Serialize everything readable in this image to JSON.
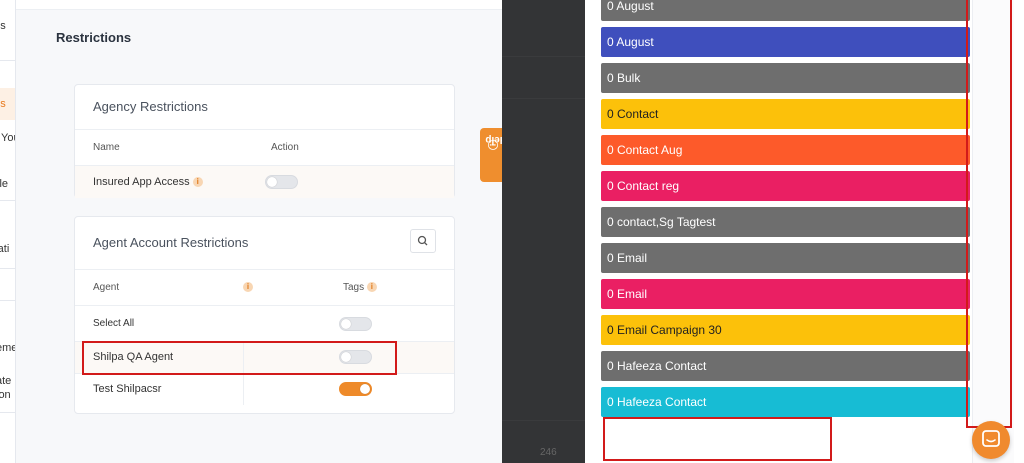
{
  "sidebar": {
    "fragments": [
      "ons",
      "ons",
      "You",
      "ile",
      "rati",
      "eme",
      "ate",
      "ion"
    ]
  },
  "page": {
    "title": "Restrictions"
  },
  "agency_card": {
    "title": "Agency Restrictions",
    "col_name": "Name",
    "col_action": "Action",
    "rows": [
      {
        "label": "Insured App Access",
        "enabled": false
      }
    ]
  },
  "agent_card": {
    "title": "Agent Account Restrictions",
    "col_agent": "Agent",
    "col_tags": "Tags",
    "rows": [
      {
        "label": "Select All",
        "enabled": false
      },
      {
        "label": "Shilpa QA Agent",
        "enabled": false
      },
      {
        "label": "Test Shilpacsr",
        "enabled": true
      }
    ]
  },
  "help": {
    "label": "Help"
  },
  "overlay": {
    "number": "246"
  },
  "tags": [
    {
      "label": "0 August",
      "color": "#6e6e6e",
      "text_color": "#ffffff"
    },
    {
      "label": "0 August",
      "color": "#3f4fbd",
      "text_color": "#ffffff"
    },
    {
      "label": "0 Bulk",
      "color": "#6e6e6e",
      "text_color": "#ffffff"
    },
    {
      "label": "0 Contact",
      "color": "#fcc10a",
      "text_color": "#222222"
    },
    {
      "label": "0 Contact Aug",
      "color": "#fd5a2a",
      "text_color": "#ffffff"
    },
    {
      "label": "0 Contact reg",
      "color": "#ea1f63",
      "text_color": "#ffffff"
    },
    {
      "label": "0 contact,Sg Tagtest",
      "color": "#6e6e6e",
      "text_color": "#ffffff"
    },
    {
      "label": "0 Email",
      "color": "#6e6e6e",
      "text_color": "#ffffff"
    },
    {
      "label": "0 Email",
      "color": "#ea1f63",
      "text_color": "#ffffff"
    },
    {
      "label": "0 Email Campaign 30",
      "color": "#fcc10a",
      "text_color": "#222222"
    },
    {
      "label": "0 Hafeeza Contact",
      "color": "#6e6e6e",
      "text_color": "#ffffff"
    },
    {
      "label": "0 Hafeeza Contact",
      "color": "#17bcd4",
      "text_color": "#ffffff"
    }
  ],
  "colors": {
    "accent": "#ef8e2e",
    "highlight": "#d21a1a"
  }
}
